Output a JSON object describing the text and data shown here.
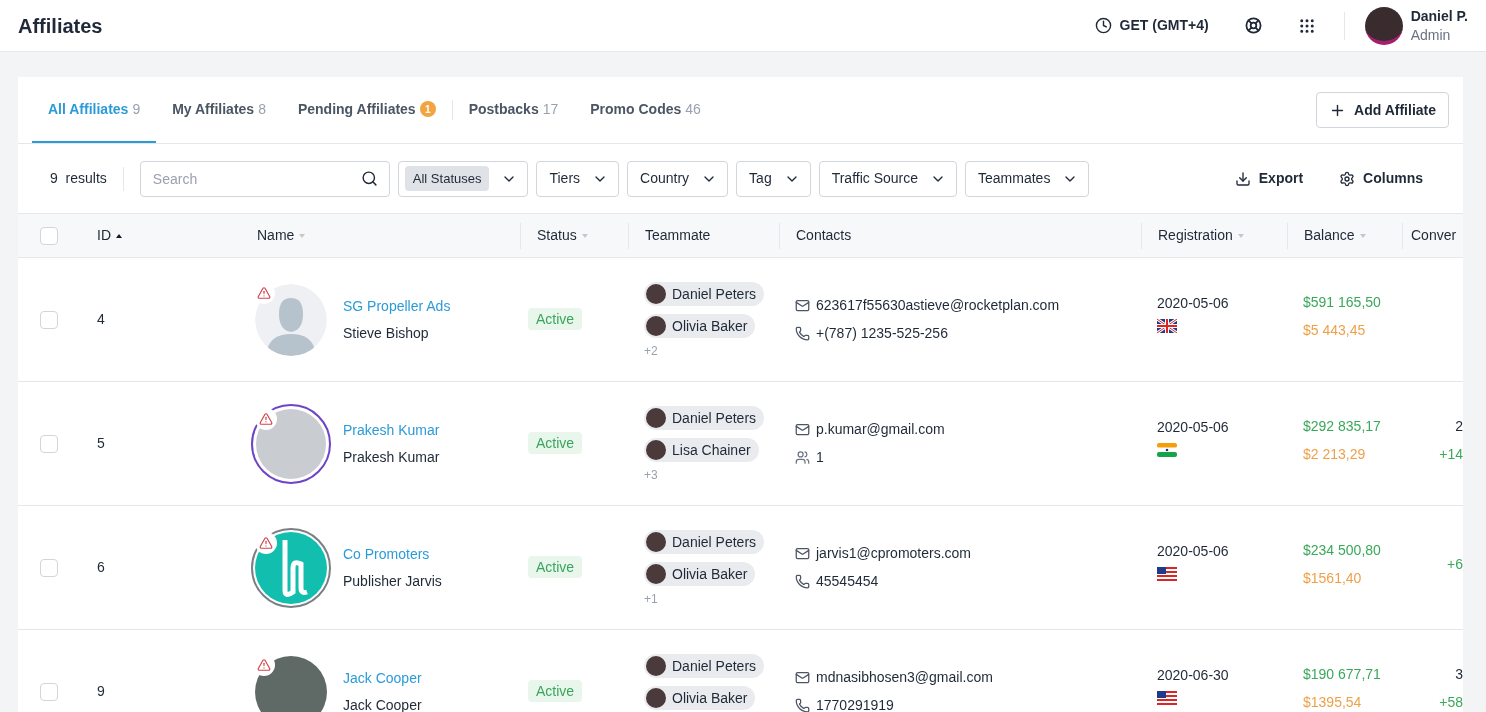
{
  "header": {
    "title": "Affiliates",
    "timezone": "GET (GMT+4)",
    "user": {
      "name": "Daniel P.",
      "role": "Admin"
    }
  },
  "tabs": [
    {
      "label": "All Affiliates",
      "count": "9",
      "kind": "count",
      "selected": true
    },
    {
      "label": "My Affiliates",
      "count": "8",
      "kind": "count",
      "selected": false
    },
    {
      "label": "Pending Affiliates",
      "count": "1",
      "kind": "badge",
      "selected": false
    },
    {
      "label": "Postbacks",
      "count": "17",
      "kind": "count",
      "selected": false
    },
    {
      "label": "Promo Codes",
      "count": "46",
      "kind": "count",
      "selected": false
    }
  ],
  "add_button": "Add Affiliate",
  "toolbar": {
    "results_count": "9",
    "results_label": "results",
    "search": {
      "placeholder": "Search"
    },
    "filters": [
      {
        "label": "All Statuses",
        "kind": "chip"
      },
      {
        "label": "Tiers",
        "kind": "plain"
      },
      {
        "label": "Country",
        "kind": "plain"
      },
      {
        "label": "Tag",
        "kind": "plain"
      },
      {
        "label": "Traffic Source",
        "kind": "plain"
      },
      {
        "label": "Teammates",
        "kind": "plain"
      }
    ],
    "export": "Export",
    "columns": "Columns"
  },
  "table": {
    "all_checked": false,
    "columns": [
      {
        "label": "ID",
        "kind": "up"
      },
      {
        "label": "Name",
        "kind": "down"
      },
      {
        "label": "Status",
        "kind": "down"
      },
      {
        "label": "Teammate",
        "kind": "none"
      },
      {
        "label": "Contacts",
        "kind": "none"
      },
      {
        "label": "Registration",
        "kind": "down"
      },
      {
        "label": "Balance",
        "kind": "down"
      },
      {
        "label": "Conver",
        "kind": "none"
      }
    ],
    "rows": [
      {
        "checked": false,
        "id": "4",
        "avatar": {
          "kind": "placeholder"
        },
        "company": "SG Propeller Ads",
        "person": "Stieve Bishop",
        "status": {
          "label": "Active",
          "kind": "active"
        },
        "teammates": [
          "Daniel Peters",
          "Olivia Baker"
        ],
        "more": "+2",
        "email": "623617f55630astieve@rocketplan.com",
        "contact": {
          "kind": "phone",
          "value": "+(787) 1235-525-256"
        },
        "registration": "2020-05-06",
        "flag": {
          "kind": "uk"
        },
        "balance": "$591 165,50",
        "pending": "$5 443,45",
        "conversion": []
      },
      {
        "checked": false,
        "id": "5",
        "avatar": {
          "kind": "ringed"
        },
        "company": "Prakesh Kumar",
        "person": "Prakesh Kumar",
        "status": {
          "label": "Active",
          "kind": "active"
        },
        "teammates": [
          "Daniel Peters",
          "Lisa Chainer"
        ],
        "more": "+3",
        "email": "p.kumar@gmail.com",
        "contact": {
          "kind": "teams",
          "value": "1"
        },
        "registration": "2020-05-06",
        "flag": {
          "kind": "in"
        },
        "balance": "$292 835,17",
        "pending": "$2 213,29",
        "conversion": [
          "2",
          "+14"
        ]
      },
      {
        "checked": false,
        "id": "6",
        "avatar": {
          "kind": "logo"
        },
        "company": "Co Promoters",
        "person": "Publisher Jarvis",
        "status": {
          "label": "Active",
          "kind": "active"
        },
        "teammates": [
          "Daniel Peters",
          "Olivia Baker"
        ],
        "more": "+1",
        "email": "jarvis1@cpromoters.com",
        "contact": {
          "kind": "phone",
          "value": "45545454"
        },
        "registration": "2020-05-06",
        "flag": {
          "kind": "us"
        },
        "balance": "$234 500,80",
        "pending": "$1561,40",
        "conversion": [
          "+6"
        ]
      },
      {
        "checked": false,
        "id": "9",
        "avatar": {
          "kind": "photo"
        },
        "company": "Jack Cooper",
        "person": "Jack Cooper",
        "status": {
          "label": "Active",
          "kind": "active"
        },
        "teammates": [
          "Daniel Peters",
          "Olivia Baker"
        ],
        "email": "mdnasibhosen3@gmail.com",
        "contact": {
          "kind": "phone",
          "value": "1770291919"
        },
        "registration": "2020-06-30",
        "flag": {
          "kind": "us"
        },
        "balance": "$190 677,71",
        "pending": "$1395,54",
        "conversion": [
          "3",
          "+58"
        ]
      }
    ]
  }
}
